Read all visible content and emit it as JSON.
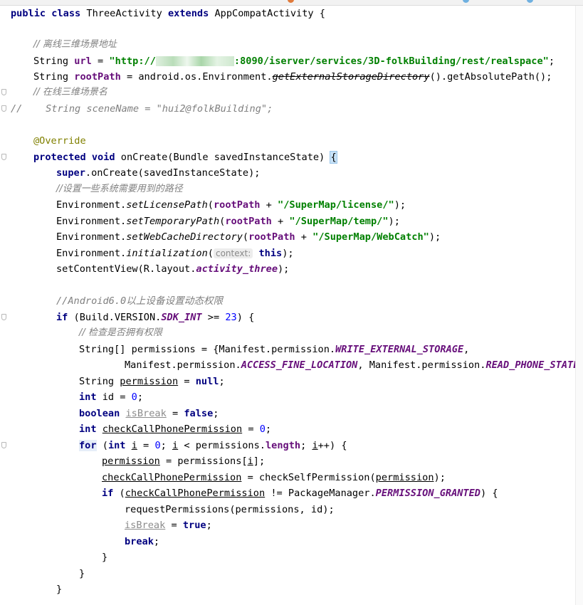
{
  "code": {
    "l1": [
      "public",
      "class",
      "ThreeActivity",
      "extends",
      "AppCompatActivity {"
    ],
    "c_offline": "// 离线三维场景地址",
    "url_decl": [
      "String ",
      "url",
      " = ",
      "\"http://",
      ":8090/iserver/services/3D-folkBuilding/rest/realspace\"",
      ";"
    ],
    "root_decl": [
      "String ",
      "rootPath",
      " = android.os.Environment.",
      "getExternalStorageDirectory",
      "().getAbsolutePath();"
    ],
    "c_online": "// 在线三维场景名",
    "scene_comment": "//    String sceneName = \"hui2@folkBuilding\";",
    "override": "@Override",
    "oncreate": [
      "protected",
      "void",
      "onCreate(Bundle savedInstanceState) ",
      "{"
    ],
    "super_call": [
      "super",
      ".onCreate(savedInstanceState);"
    ],
    "c_paths": "//设置一些系统需要用到的路径",
    "set_license": [
      "Environment.",
      "setLicensePath",
      "(",
      "rootPath",
      " + ",
      "\"/SuperMap/license/\"",
      ");"
    ],
    "set_temp": [
      "Environment.",
      "setTemporaryPath",
      "(",
      "rootPath",
      " + ",
      "\"/SuperMap/temp/\"",
      ");"
    ],
    "set_cache": [
      "Environment.",
      "setWebCacheDirectory",
      "(",
      "rootPath",
      " + ",
      "\"/SuperMap/WebCatch\"",
      ");"
    ],
    "init": [
      "Environment.",
      "initialization",
      "(",
      "context:",
      "this",
      ");"
    ],
    "set_content": [
      "setContentView(R.layout.",
      "activity_three",
      ");"
    ],
    "c_android6": "//Android6.0以上设备设置动态权限",
    "if_sdk": [
      "if",
      " (Build.VERSION.",
      "SDK_INT",
      " >= ",
      "23",
      ") {"
    ],
    "c_check": "// 检查是否拥有权限",
    "perm_arr1": [
      "String[] permissions = {Manifest.permission.",
      "WRITE_EXTERNAL_STORAGE",
      ","
    ],
    "perm_arr2": [
      "Manifest.permission.",
      "ACCESS_FINE_LOCATION",
      ", Manifest.permission.",
      "READ_PHONE_STATE",
      "};"
    ],
    "perm_var": [
      "String ",
      "permission",
      " = ",
      "null",
      ";"
    ],
    "id_var": [
      "int",
      " id = ",
      "0",
      ";"
    ],
    "break_var": [
      "boolean",
      "isBreak",
      " = ",
      "false",
      ";"
    ],
    "check_var": [
      "int",
      "checkCallPhonePermission",
      " = ",
      "0",
      ";"
    ],
    "for_loop": [
      "for",
      " (",
      "int",
      "i",
      " = ",
      "0",
      "; ",
      "i",
      " < permissions.",
      "length",
      "; ",
      "i",
      "++) {"
    ],
    "assign_perm": [
      "permission",
      " = permissions[",
      "i",
      "];"
    ],
    "assign_check": [
      "checkCallPhonePermission",
      " = checkSelfPermission(",
      "permission",
      ");"
    ],
    "if_granted": [
      "if",
      " (",
      "checkCallPhonePermission",
      " != PackageManager.",
      "PERMISSION_GRANTED",
      ") {"
    ],
    "request": "requestPermissions(permissions, id);",
    "set_break": [
      "isBreak",
      " = ",
      "true",
      ";"
    ],
    "break_stmt": [
      "break",
      ";"
    ],
    "close": "}"
  },
  "colors": {
    "keyword": "#000080",
    "string": "#008000",
    "field": "#660e7a",
    "comment": "#808080",
    "number": "#0000ff",
    "annotation": "#808000",
    "brace_highlight": "#c8e2f7"
  }
}
